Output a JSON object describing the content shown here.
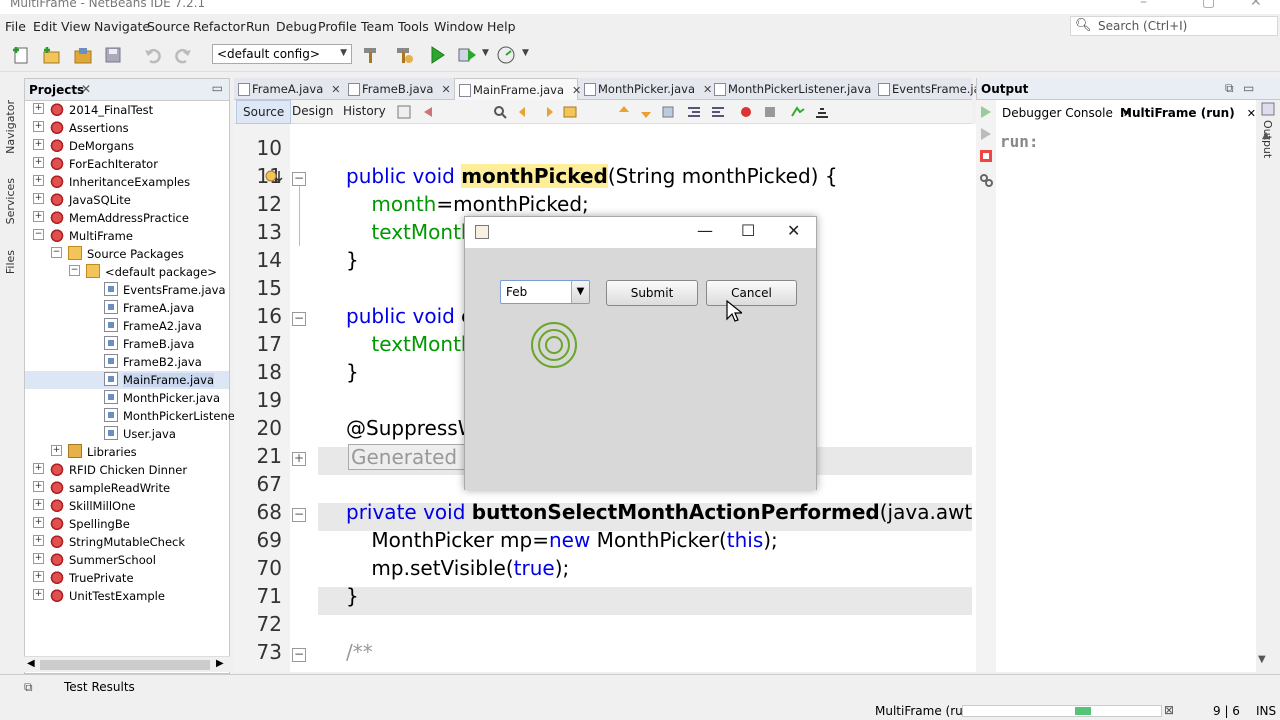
{
  "window": {
    "title": "MultiFrame - NetBeans IDE 7.2.1"
  },
  "menu": [
    "File",
    "Edit",
    "View",
    "Navigate",
    "Source",
    "Refactor",
    "Run",
    "Debug",
    "Profile",
    "Team",
    "Tools",
    "Window",
    "Help"
  ],
  "search": {
    "placeholder": "Search (Ctrl+I)"
  },
  "toolbar": {
    "config_value": "<default config>"
  },
  "side_tabs": {
    "navigator": "Navigator",
    "services": "Services",
    "files": "Files"
  },
  "projects": {
    "title": "Projects",
    "items": [
      {
        "label": "2014_FinalTest",
        "level": 0,
        "type": "project",
        "expanded": false
      },
      {
        "label": "Assertions",
        "level": 0,
        "type": "project",
        "expanded": false
      },
      {
        "label": "DeMorgans",
        "level": 0,
        "type": "project",
        "expanded": false
      },
      {
        "label": "ForEachIterator",
        "level": 0,
        "type": "project",
        "expanded": false
      },
      {
        "label": "InheritanceExamples",
        "level": 0,
        "type": "project",
        "expanded": false
      },
      {
        "label": "JavaSQLite",
        "level": 0,
        "type": "project",
        "expanded": false
      },
      {
        "label": "MemAddressPractice",
        "level": 0,
        "type": "project",
        "expanded": false
      },
      {
        "label": "MultiFrame",
        "level": 0,
        "type": "project",
        "expanded": true
      },
      {
        "label": "Source Packages",
        "level": 1,
        "type": "package",
        "expanded": true
      },
      {
        "label": "<default package>",
        "level": 2,
        "type": "package",
        "expanded": true
      },
      {
        "label": "EventsFrame.java",
        "level": 3,
        "type": "file"
      },
      {
        "label": "FrameA.java",
        "level": 3,
        "type": "file"
      },
      {
        "label": "FrameA2.java",
        "level": 3,
        "type": "file"
      },
      {
        "label": "FrameB.java",
        "level": 3,
        "type": "file"
      },
      {
        "label": "FrameB2.java",
        "level": 3,
        "type": "file"
      },
      {
        "label": "MainFrame.java",
        "level": 3,
        "type": "file",
        "selected": true
      },
      {
        "label": "MonthPicker.java",
        "level": 3,
        "type": "file"
      },
      {
        "label": "MonthPickerListener.j",
        "level": 3,
        "type": "file"
      },
      {
        "label": "User.java",
        "level": 3,
        "type": "file"
      },
      {
        "label": "Libraries",
        "level": 1,
        "type": "library",
        "expanded": false
      },
      {
        "label": "RFID Chicken Dinner",
        "level": 0,
        "type": "project",
        "expanded": false
      },
      {
        "label": "sampleReadWrite",
        "level": 0,
        "type": "project",
        "expanded": false
      },
      {
        "label": "SkillMillOne",
        "level": 0,
        "type": "project",
        "expanded": false
      },
      {
        "label": "SpellingBe",
        "level": 0,
        "type": "project",
        "expanded": false
      },
      {
        "label": "StringMutableCheck",
        "level": 0,
        "type": "project",
        "expanded": false
      },
      {
        "label": "SummerSchool",
        "level": 0,
        "type": "project",
        "expanded": false
      },
      {
        "label": "TruePrivate",
        "level": 0,
        "type": "project",
        "expanded": false
      },
      {
        "label": "UnitTestExample",
        "level": 0,
        "type": "project",
        "expanded": false
      }
    ]
  },
  "editor": {
    "tabs": [
      "FrameA.java",
      "FrameB.java",
      "MainFrame.java",
      "MonthPicker.java",
      "MonthPickerListener.java",
      "EventsFrame.ja"
    ],
    "active_tab": "MainFrame.java",
    "views": [
      "Source",
      "Design",
      "History"
    ],
    "lines": [
      {
        "n": "10",
        "segs": []
      },
      {
        "n": "11",
        "segs": [
          {
            "t": "public void ",
            "c": "kw"
          },
          {
            "t": "monthPicked",
            "c": "hl"
          },
          {
            "t": "(String monthPicked) {",
            "c": ""
          }
        ]
      },
      {
        "n": "12",
        "segs": [
          {
            "t": "    month",
            "c": "grn"
          },
          {
            "t": "=monthPicked;",
            "c": ""
          }
        ]
      },
      {
        "n": "13",
        "segs": [
          {
            "t": "    textMonth",
            "c": "grn"
          }
        ]
      },
      {
        "n": "14",
        "segs": [
          {
            "t": "}",
            "c": ""
          }
        ]
      },
      {
        "n": "15",
        "segs": []
      },
      {
        "n": "16",
        "segs": [
          {
            "t": "public void ",
            "c": "kw"
          },
          {
            "t": "c",
            "c": "bold"
          }
        ]
      },
      {
        "n": "17",
        "segs": [
          {
            "t": "    textMonth",
            "c": "grn"
          }
        ]
      },
      {
        "n": "18",
        "segs": [
          {
            "t": "}",
            "c": ""
          }
        ]
      },
      {
        "n": "19",
        "segs": []
      },
      {
        "n": "20",
        "segs": [
          {
            "t": "@SuppressW",
            "c": ""
          }
        ]
      },
      {
        "n": "21",
        "segs": [
          {
            "t": "Generated C",
            "c": "gray"
          }
        ]
      },
      {
        "n": "67",
        "segs": []
      },
      {
        "n": "68",
        "segs": [
          {
            "t": "private void ",
            "c": "kw"
          },
          {
            "t": "buttonSelectMonthActionPerformed",
            "c": "bold"
          },
          {
            "t": "(java.awt.e",
            "c": ""
          }
        ]
      },
      {
        "n": "69",
        "segs": [
          {
            "t": "    MonthPicker mp=",
            "c": ""
          },
          {
            "t": "new",
            "c": "kw"
          },
          {
            "t": " MonthPicker(",
            "c": ""
          },
          {
            "t": "this",
            "c": "kw"
          },
          {
            "t": ");",
            "c": ""
          }
        ]
      },
      {
        "n": "70",
        "segs": [
          {
            "t": "    mp.setVisible(",
            "c": ""
          },
          {
            "t": "true",
            "c": "kw"
          },
          {
            "t": ");",
            "c": ""
          }
        ]
      },
      {
        "n": "71",
        "segs": [
          {
            "t": "}",
            "c": ""
          }
        ]
      },
      {
        "n": "72",
        "segs": []
      },
      {
        "n": "73",
        "segs": [
          {
            "t": "/**",
            "c": "gray"
          }
        ]
      }
    ]
  },
  "output": {
    "title": "Output",
    "tabs": [
      "Debugger Console",
      "MultiFrame (run)"
    ],
    "active_tab": "MultiFrame (run)",
    "text": "run:",
    "side_label": "Output"
  },
  "dialog": {
    "combo_value": "Feb",
    "submit_label": "Submit",
    "cancel_label": "Cancel"
  },
  "statusbar": {
    "test_results": "Test Results",
    "run_label": "MultiFrame (run)",
    "position": "9 | 6",
    "mode": "INS"
  },
  "colors": {
    "accent": "#0000e6",
    "highlight": "#ffee99",
    "string_green": "#009900"
  }
}
